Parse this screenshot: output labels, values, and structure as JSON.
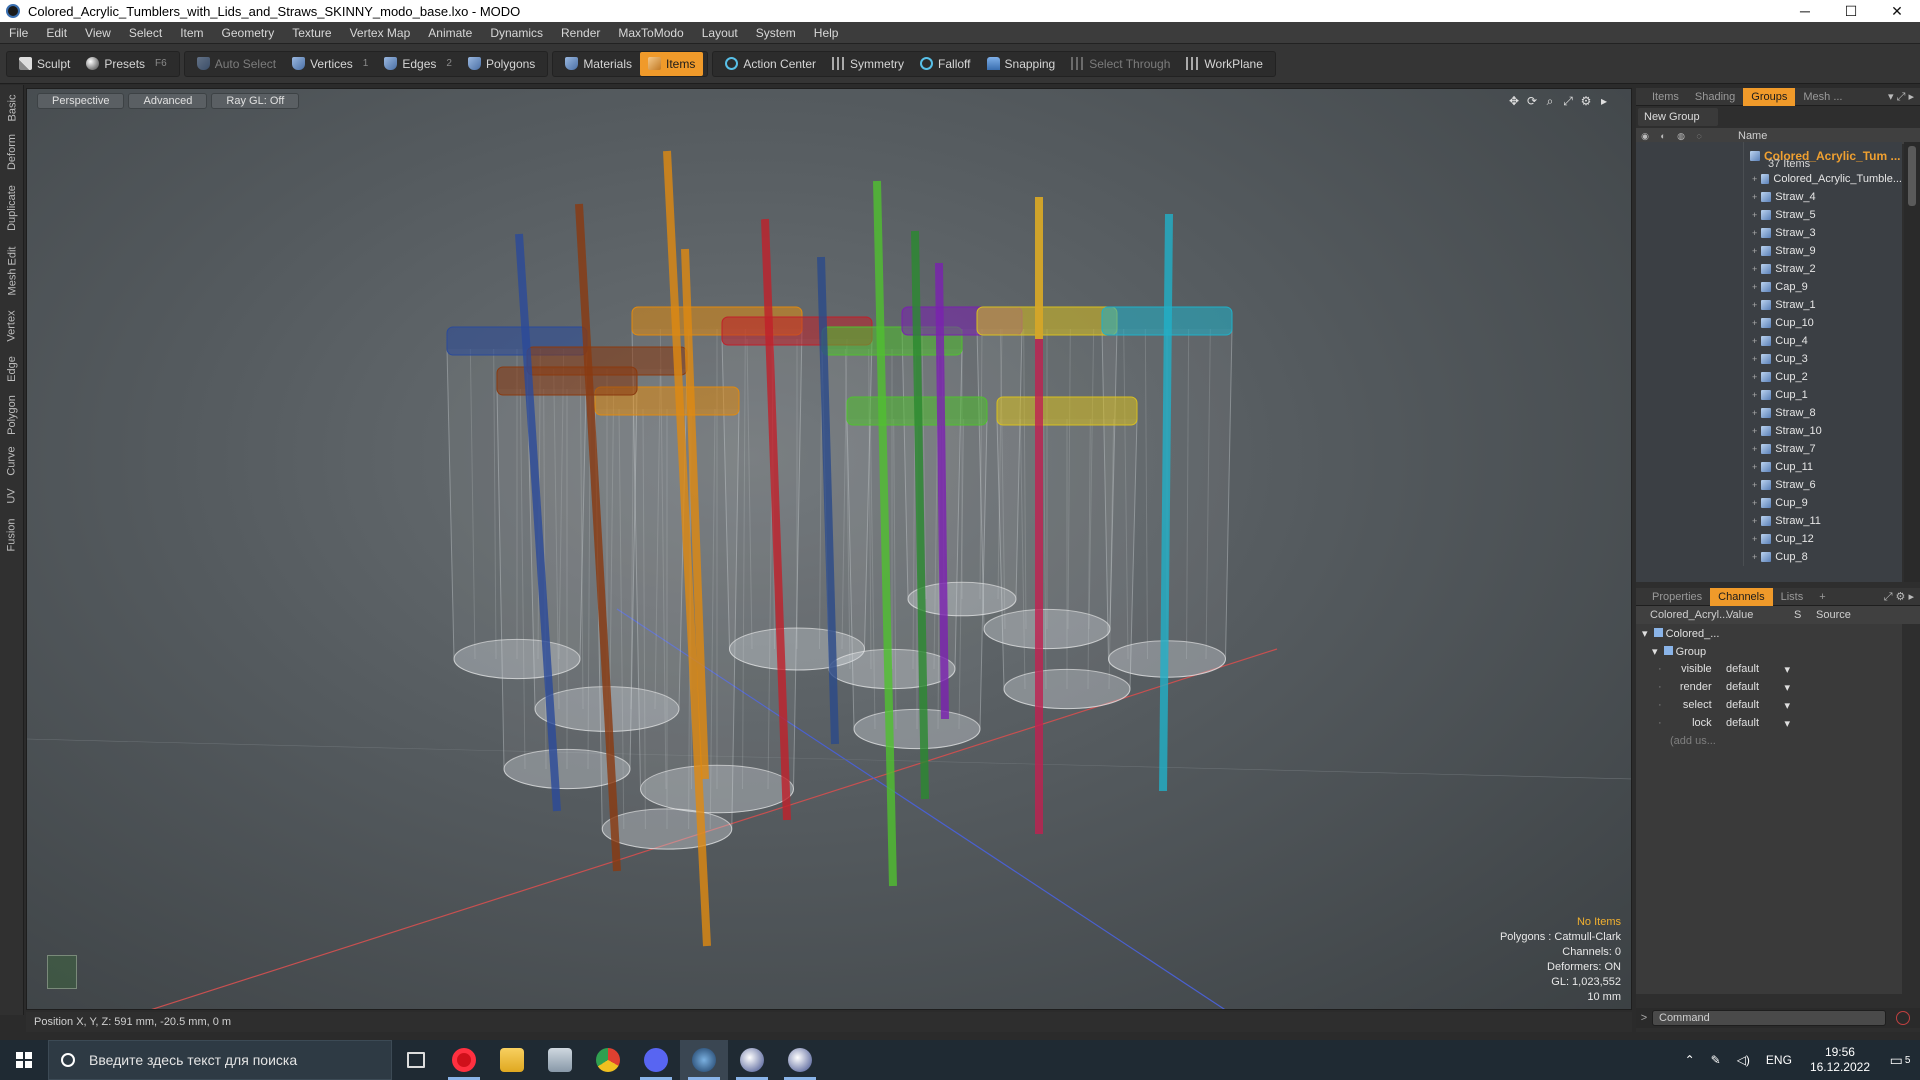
{
  "window": {
    "title": "Colored_Acrylic_Tumblers_with_Lids_and_Straws_SKINNY_modo_base.lxo - MODO",
    "minimize": "─",
    "maximize": "☐",
    "close": "✕"
  },
  "menu": [
    "File",
    "Edit",
    "View",
    "Select",
    "Item",
    "Geometry",
    "Texture",
    "Vertex Map",
    "Animate",
    "Dynamics",
    "Render",
    "MaxToModo",
    "Layout",
    "System",
    "Help"
  ],
  "toolbar": {
    "sculpt": "Sculpt",
    "presets": "Presets",
    "presets_key": "F6",
    "auto_select": "Auto Select",
    "vertices": "Vertices",
    "vertices_key": "1",
    "edges": "Edges",
    "edges_key": "2",
    "polygons": "Polygons",
    "materials": "Materials",
    "items": "Items",
    "action_center": "Action Center",
    "symmetry": "Symmetry",
    "falloff": "Falloff",
    "snapping": "Snapping",
    "select_through": "Select Through",
    "workplane": "WorkPlane"
  },
  "left_tabs": [
    "Basic",
    "Deform",
    "Duplicate",
    "Mesh Edit",
    "Vertex",
    "Edge",
    "Polygon",
    "Curve",
    "UV",
    "Fusion"
  ],
  "viewport": {
    "tabs": [
      "Perspective",
      "Advanced",
      "Ray GL: Off"
    ],
    "info": {
      "selection": "No Items",
      "polygons": "Polygons : Catmull-Clark",
      "channels": "Channels: 0",
      "deformers": "Deformers: ON",
      "gl": "GL: 1,023,552",
      "scale": "10 mm"
    },
    "accent_warn": "#f0b030"
  },
  "status": {
    "position": "Position X, Y, Z:  591 mm, -20.5 mm, 0 m"
  },
  "groups_panel": {
    "tabs": [
      "Items",
      "Shading",
      "Groups",
      "Mesh ..."
    ],
    "active_tab": "Groups",
    "new_group": "New Group",
    "column_name": "Name",
    "group_name": "Colored_Acrylic_Tum ...",
    "group_count": "37 Items",
    "items": [
      "Colored_Acrylic_Tumble...",
      "Straw_4",
      "Straw_5",
      "Straw_3",
      "Straw_9",
      "Straw_2",
      "Cap_9",
      "Straw_1",
      "Cup_10",
      "Cup_4",
      "Cup_3",
      "Cup_2",
      "Cup_1",
      "Straw_8",
      "Straw_10",
      "Straw_7",
      "Cup_11",
      "Straw_6",
      "Cup_9",
      "Straw_11",
      "Cup_12",
      "Cup_8"
    ]
  },
  "channels_panel": {
    "tabs": [
      "Properties",
      "Channels",
      "Lists"
    ],
    "active_tab": "Channels",
    "add_tab": "+",
    "headers": {
      "name": "Colored_Acryl...",
      "value": "Value",
      "s": "S",
      "source": "Source"
    },
    "root": "Colored_...",
    "group": "Group",
    "rows": [
      {
        "name": "visible",
        "value": "default"
      },
      {
        "name": "render",
        "value": "default"
      },
      {
        "name": "select",
        "value": "default"
      },
      {
        "name": "lock",
        "value": "default"
      }
    ],
    "add_user": "(add us..."
  },
  "command": {
    "prompt": ">",
    "placeholder": "Command"
  },
  "taskbar": {
    "search_placeholder": "Введите здесь текст для поиска",
    "lang": "ENG",
    "time": "19:56",
    "date": "16.12.2022",
    "notif_count": "5"
  },
  "straw_colors": {
    "blue": "#2a4a9a",
    "brown": "#8a3a10",
    "orange": "#e08a10",
    "red": "#c0202a",
    "navy": "#2a4a8a",
    "green": "#50c030",
    "dkgreen": "#2a8a30",
    "purple": "#7a20b0",
    "crimson": "#c02050",
    "yellow": "#d8c020",
    "cyan": "#20b0c8"
  }
}
